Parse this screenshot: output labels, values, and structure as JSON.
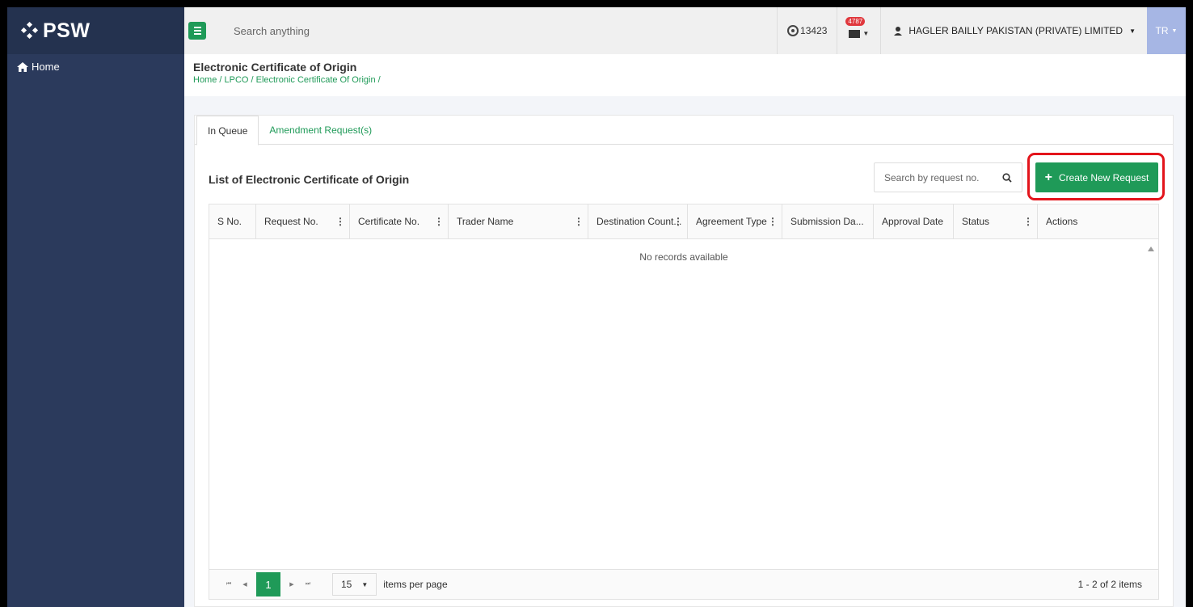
{
  "brand": {
    "name": "PSW"
  },
  "sidebar": {
    "items": [
      {
        "label": "Home",
        "icon": "home-icon"
      }
    ]
  },
  "topbar": {
    "search_placeholder": "Search anything",
    "counter": "13423",
    "mail_badge": "4787",
    "user_name": "HAGLER BAILLY PAKISTAN (PRIVATE) LIMITED",
    "user_initials": "TR"
  },
  "page": {
    "title": "Electronic Certificate of Origin",
    "breadcrumb": "Home / LPCO / Electronic Certificate Of Origin /"
  },
  "tabs": [
    {
      "label": "In Queue",
      "active": true
    },
    {
      "label": "Amendment Request(s)",
      "active": false
    }
  ],
  "list": {
    "title": "List of Electronic Certificate of Origin",
    "search_placeholder": "Search by request no.",
    "create_label": "Create New Request"
  },
  "grid": {
    "columns": [
      "S No.",
      "Request No.",
      "Certificate No.",
      "Trader Name",
      "Destination Count...",
      "Agreement Type",
      "Submission Da...",
      "Approval Date",
      "Status",
      "Actions"
    ],
    "empty_text": "No records available"
  },
  "pager": {
    "current_page": "1",
    "page_size": "15",
    "per_page_label": "items per page",
    "items_info": "1 - 2 of 2 items"
  },
  "colors": {
    "accent": "#1f9a58",
    "sidebar": "#2b3a5c",
    "highlight": "#e3141b"
  }
}
